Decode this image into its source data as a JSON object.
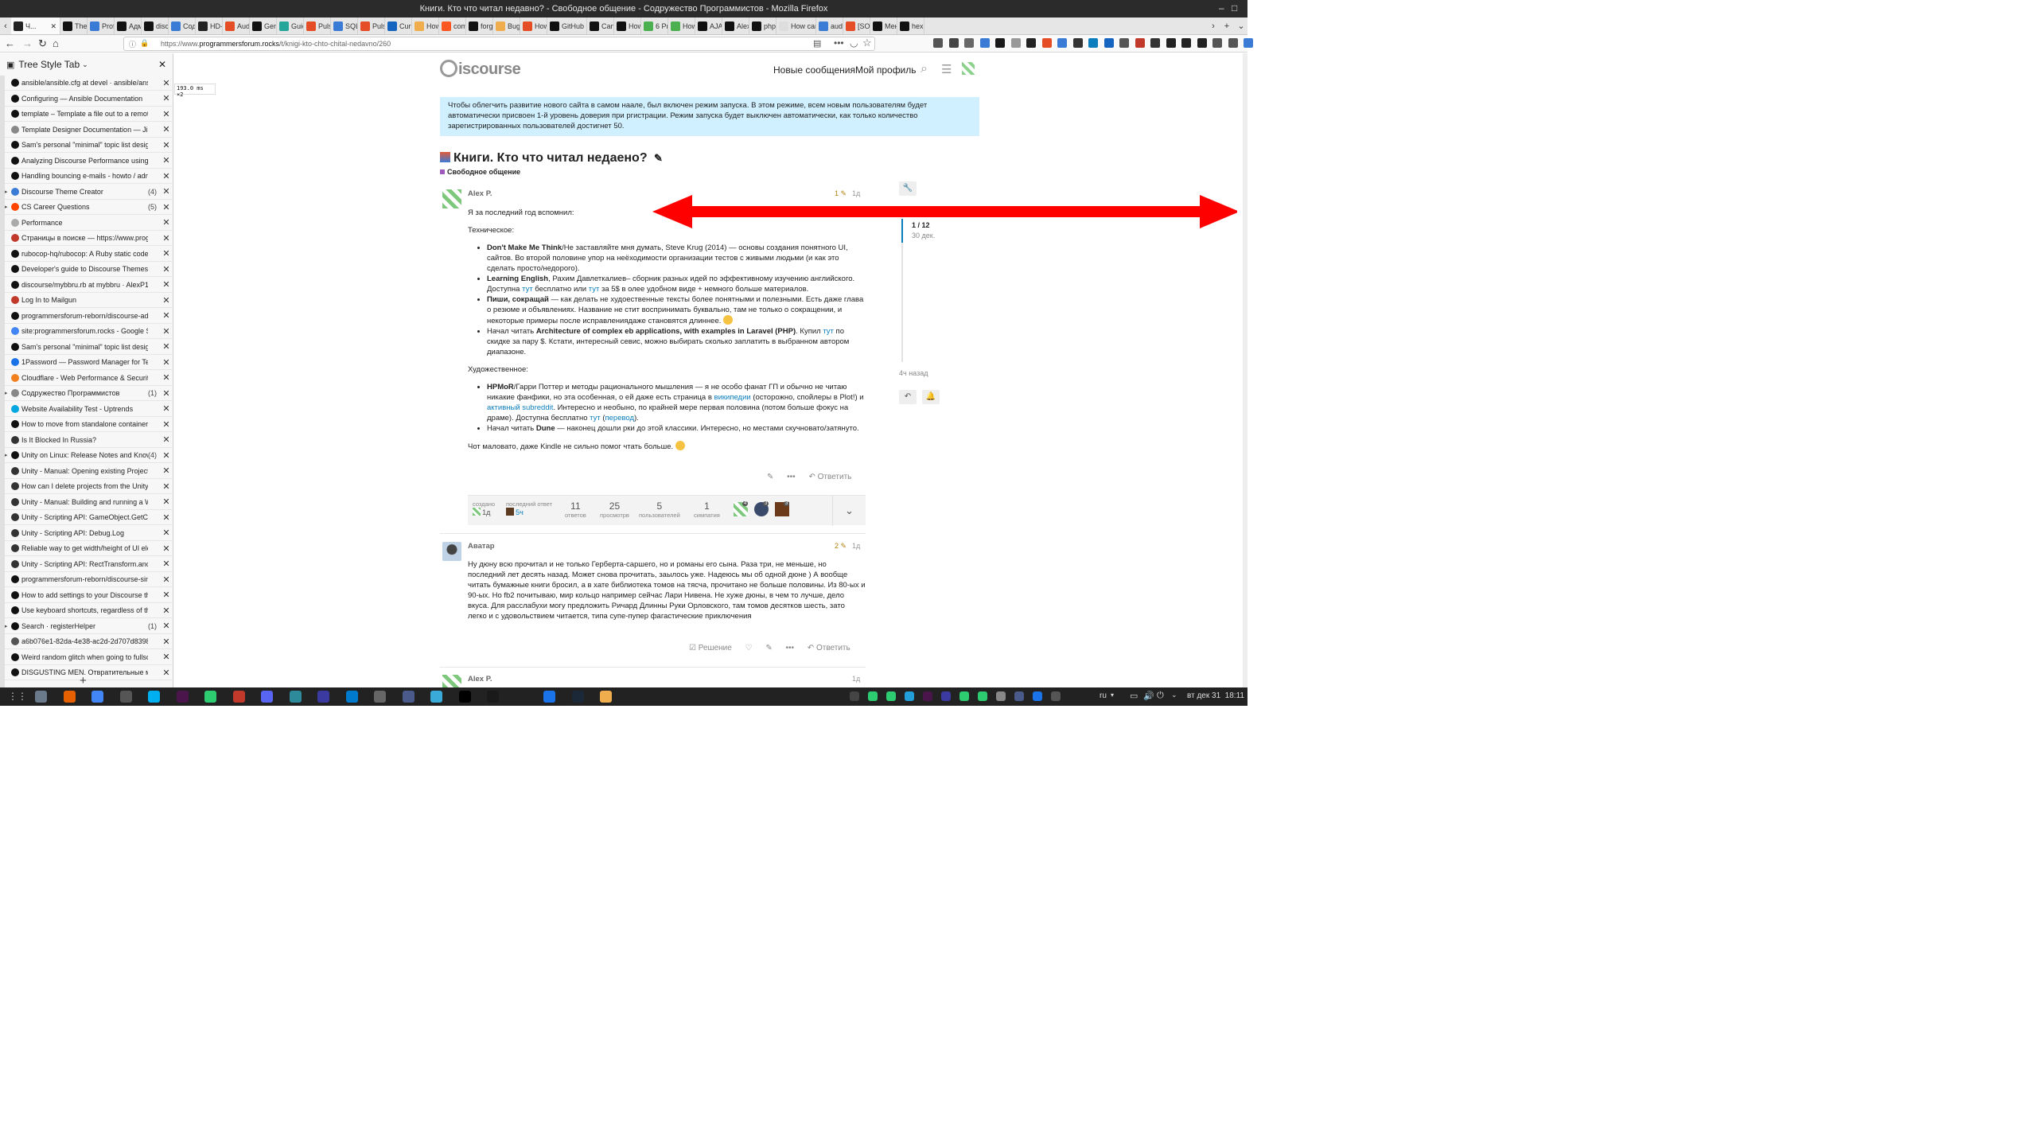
{
  "window": {
    "title": "Книги. Кто что читал недавно? - Свободное общение - Содружество Программистов - Mozilla Firefox"
  },
  "tabs": [
    {
      "label": "Ч...",
      "color": "#222",
      "active": true
    },
    {
      "label": "Them",
      "color": "#111"
    },
    {
      "label": "Profi",
      "color": "#3a7bd5"
    },
    {
      "label": "Адми",
      "color": "#111"
    },
    {
      "label": "disco",
      "color": "#111"
    },
    {
      "label": "Содр",
      "color": "#3a7bd5"
    },
    {
      "label": "HD-Tr",
      "color": "#222"
    },
    {
      "label": "Audi",
      "color": "#e44d26"
    },
    {
      "label": "Gene",
      "color": "#111"
    },
    {
      "label": "Guid",
      "color": "#26a69a"
    },
    {
      "label": "Pulse",
      "color": "#e44d26"
    },
    {
      "label": "SQLit",
      "color": "#3a7bd5"
    },
    {
      "label": "Pulse",
      "color": "#e44d26"
    },
    {
      "label": "Curre",
      "color": "#1565c0"
    },
    {
      "label": "How",
      "color": "#f0ad4e"
    },
    {
      "label": "comr",
      "color": "#ff5722"
    },
    {
      "label": "forg",
      "color": "#111"
    },
    {
      "label": "Bug a",
      "color": "#f0ad4e"
    },
    {
      "label": "How",
      "color": "#e44d26"
    },
    {
      "label": "GitHub c",
      "color": "#111"
    },
    {
      "label": "Can I",
      "color": "#111"
    },
    {
      "label": "How",
      "color": "#111"
    },
    {
      "label": "6 Pro",
      "color": "#4caf50"
    },
    {
      "label": "How",
      "color": "#4caf50"
    },
    {
      "label": "AJAX",
      "color": "#111"
    },
    {
      "label": "AlexP",
      "color": "#111"
    },
    {
      "label": "php-j",
      "color": "#111"
    },
    {
      "label": "How can",
      "color": "#ddd"
    },
    {
      "label": "audio",
      "color": "#3a7bd5"
    },
    {
      "label": "[SOLV",
      "color": "#e44d26"
    },
    {
      "label": "Мено",
      "color": "#111"
    },
    {
      "label": "hexle",
      "color": "#111"
    }
  ],
  "nav": {
    "url_prefix": "https://www.",
    "url_domain": "programmersforum.rocks",
    "url_path": "/t/knigi-kto-chto-chital-nedavno/260"
  },
  "sidebar": {
    "title": "Tree Style Tab",
    "items": [
      {
        "label": "ansible/ansible.cfg at devel · ansible/ansible",
        "count": "",
        "twisty": "",
        "color": "#111"
      },
      {
        "label": "Configuring — Ansible Documentation",
        "count": "",
        "twisty": "",
        "color": "#111"
      },
      {
        "label": "template – Template a file out to a remote se",
        "count": "",
        "twisty": "",
        "color": "#111"
      },
      {
        "label": "Template Designer Documentation — Jinja Do",
        "count": "",
        "twisty": "",
        "color": "#888"
      },
      {
        "label": "Sam's personal \"minimal\" topic list design - E",
        "count": "",
        "twisty": "",
        "color": "#111"
      },
      {
        "label": "Analyzing Discourse Performance using NGIN",
        "count": "",
        "twisty": "",
        "color": "#111"
      },
      {
        "label": "Handling bouncing e-mails - howto / admins",
        "count": "",
        "twisty": "",
        "color": "#111"
      },
      {
        "label": "Discourse Theme Creator",
        "count": "(4)",
        "twisty": "▸",
        "color": "#3a7bd5"
      },
      {
        "label": "CS Career Questions",
        "count": "(5)",
        "twisty": "▸",
        "color": "#ff4500"
      },
      {
        "label": "Performance",
        "count": "",
        "twisty": "",
        "color": "#aaa"
      },
      {
        "label": "Страницы в поиске — https://www.programm",
        "count": "",
        "twisty": "",
        "color": "#c0392b"
      },
      {
        "label": "rubocop-hq/rubocop: A Ruby static code ana",
        "count": "",
        "twisty": "",
        "color": "#111"
      },
      {
        "label": "Developer's guide to Discourse Themes - how",
        "count": "",
        "twisty": "",
        "color": "#111"
      },
      {
        "label": "discourse/mybbru.rb at mybbru · AlexP11223",
        "count": "",
        "twisty": "",
        "color": "#111"
      },
      {
        "label": "Log In to Mailgun",
        "count": "",
        "twisty": "",
        "color": "#c0392b"
      },
      {
        "label": "programmersforum-reborn/discourse-adjust",
        "count": "",
        "twisty": "",
        "color": "#111"
      },
      {
        "label": "site:programmersforum.rocks - Google Search",
        "count": "",
        "twisty": "",
        "color": "#4285f4"
      },
      {
        "label": "Sam's personal \"minimal\" topic list design - E",
        "count": "",
        "twisty": "",
        "color": "#111"
      },
      {
        "label": "1Password — Password Manager for Teams, B",
        "count": "",
        "twisty": "",
        "color": "#1a73e8"
      },
      {
        "label": "Cloudflare - Web Performance & Security",
        "count": "",
        "twisty": "",
        "color": "#f38020"
      },
      {
        "label": "Содружество Программистов",
        "count": "(1)",
        "twisty": "▸",
        "color": "#888"
      },
      {
        "label": "Website Availability Test - Uptrends",
        "count": "",
        "twisty": "",
        "color": "#00a7e1"
      },
      {
        "label": "How to move from standalone container to se",
        "count": "",
        "twisty": "",
        "color": "#111"
      },
      {
        "label": "Is It Blocked In Russia?",
        "count": "",
        "twisty": "",
        "color": "#333"
      },
      {
        "label": "Unity on Linux: Release Notes and Known Is",
        "count": "(4)",
        "twisty": "▸",
        "color": "#111"
      },
      {
        "label": "Unity - Manual: Opening existing Projects",
        "count": "",
        "twisty": "",
        "color": "#333"
      },
      {
        "label": "How can I delete projects from the Unity Hub",
        "count": "",
        "twisty": "",
        "color": "#333"
      },
      {
        "label": "Unity - Manual: Building and running a WebGL",
        "count": "",
        "twisty": "",
        "color": "#333"
      },
      {
        "label": "Unity - Scripting API: GameObject.GetCompon",
        "count": "",
        "twisty": "",
        "color": "#333"
      },
      {
        "label": "Unity - Scripting API: Debug.Log",
        "count": "",
        "twisty": "",
        "color": "#333"
      },
      {
        "label": "Reliable way to get width/height of UI eleme",
        "count": "",
        "twisty": "",
        "color": "#333"
      },
      {
        "label": "Unity - Scripting API: RectTransform.anchore",
        "count": "",
        "twisty": "",
        "color": "#333"
      },
      {
        "label": "programmersforum-reborn/discourse-simple",
        "count": "",
        "twisty": "",
        "color": "#111"
      },
      {
        "label": "How to add settings to your Discourse theme",
        "count": "",
        "twisty": "",
        "color": "#111"
      },
      {
        "label": "Use keyboard shortcuts, regardless of the ke",
        "count": "",
        "twisty": "",
        "color": "#111"
      },
      {
        "label": "Search · registerHelper",
        "count": "(1)",
        "twisty": "▸",
        "color": "#111"
      },
      {
        "label": "a6b076e1-82da-4e38-ac2d-2d707d83985e/opt",
        "count": "",
        "twisty": "",
        "color": "#555"
      },
      {
        "label": "Weird random glitch when going to fullscree",
        "count": "",
        "twisty": "",
        "color": "#111"
      },
      {
        "label": "DISGUSTING MEN. Отвратительные мужики",
        "count": "",
        "twisty": "",
        "color": "#111"
      }
    ]
  },
  "perf": {
    "value": "193.0",
    "unit": "ms ×2"
  },
  "discourse": {
    "logo": "iscourse",
    "header_links": {
      "new_posts": "Новые сообщения",
      "my_profile": "Мой профиль"
    },
    "banner": "Чтобы облегчить развитие нового сайта в самом наале, был включен режим запуска. В этом режиме, всем новым пользователям будет автоматически присвоен 1-й уровень доверия при ргистрации. Режим запуска будет выключен автоматически, как только количество зарегистрированных пользователей достигнет 50.",
    "topic_title": "Книги. Кто что читал недаено?",
    "category": "Свободное общение",
    "timeline": {
      "position": "1 / 12",
      "date": "30 дек.",
      "ago": "4ч назад"
    },
    "post1": {
      "author": "Alex P.",
      "edits": "1",
      "age": "1д",
      "intro": "Я за последний год вспомнил:",
      "tech_heading": "Техническое:",
      "tech": [
        {
          "bold": "Don't Make Me Think",
          "text": "/Не заставляйте мня думать, Steve Krug (2014) — основы создания понятного UI, сайтов. Во второй половине упор на неёходимости организации тестов с живыми людьми (и как это сделать просто/недорого)."
        },
        {
          "bold": "Learning English",
          "text": ", Рахим Давлеткалиев– сборник разных идей по эффективному изучению английского. Доступна ",
          "link1": "тут",
          "mid": " бесплатно или ",
          "link2": "тут",
          "tail": " за 5$ в олее удобном виде + немного больше материалов."
        },
        {
          "bold": "Пиши, сокращай",
          "text": " — как делать не худоественные тексты более понятными и полезными. Есть даже глава о резюме и объявлениях. Название не стит воспринимать буквально, там не только о сокращении, и некоторые примеры после исправлениядаже становятся длиннее."
        },
        {
          "pre": "Начал читать ",
          "bold": "Architecture of complex eb applications, with examples in Laravel (PHP)",
          "text": ". Купил ",
          "link1": "тут",
          "tail": " по скидке за пару $. Кстати, интересный севис, можно выбирать сколько заплатить в выбранном автором диапазоне."
        }
      ],
      "fiction_heading": "Художественное:",
      "fiction": [
        {
          "bold": "HPMoR",
          "text": "/Гарри Поттер и методы рационального мышления — я не особо фанат ГП и обычно не читаю никакие фанфики, но эта особенная, о ей даже есть страница в ",
          "link1": "википедии",
          "mid": " (осторожно, спойлеры в Plot!) и ",
          "link2": "активный subreddit",
          "tail": ". Интересно и необыно, по крайней мере первая половина (потом больше фокус на драме). Доступна бесплатно ",
          "link3": "тут",
          "tail2": " (",
          "link4": "перевод",
          "tail3": ")."
        },
        {
          "pre": "Начал читать ",
          "bold": "Dune",
          "text": " — наконец дошли рки до этой классики. Интересно, но местами скучновато/затянуто."
        }
      ],
      "outro": "Чот маловато, даже Kindle не сильно помог чтать больше.",
      "reply": "Ответить"
    },
    "stats": {
      "created_label": "создано",
      "created_age": "1д",
      "last_reply_label": "последний ответ",
      "last_reply_age": "5ч",
      "replies": "11",
      "replies_label": "ответов",
      "views": "25",
      "views_label": "просмотрв",
      "users": "5",
      "users_label": "пользователей",
      "likes": "1",
      "likes_label": "симпатия",
      "avatar_counts": [
        "4",
        "3",
        "3"
      ]
    },
    "post2": {
      "author": "Аватар",
      "edits": "2",
      "age": "1д",
      "body": "Ну дюну всю прочитал и не только Герберта-саршего, но и романы его сына. Раза три, не меньше, но последний лет десять назад. Может снова прочитать, зaылось уже. Надеюсь мы об одной дюне ) А вообще читать бумажные книги бросил, а в хате библиотека томов на тясча, прочитано не больше половины. Из 80-ых и 90-ых. Но fb2 почитываю, мир кольцо например сейчас Лари Нивена. Не хуже дюны, в чем то лучше, дело вкуса. Для расслабухи могу предложить Ричард Длинны Руки Орловского, там томов десятков шесть, зато легко и с удовольствием читается, типа супе-пупер фагастические приключения",
      "solution": "Решение",
      "reply": "Ответить"
    },
    "post3": {
      "author": "Alex P.",
      "age": "1д"
    }
  },
  "taskbar": {
    "lang": "ru",
    "clock": "вт дек 31  18:11"
  },
  "colors": {
    "accent": "#0a7ebd",
    "banner_bg": "#d1f0ff",
    "arrow": "#ff0000",
    "category": "#9e5ab9"
  }
}
